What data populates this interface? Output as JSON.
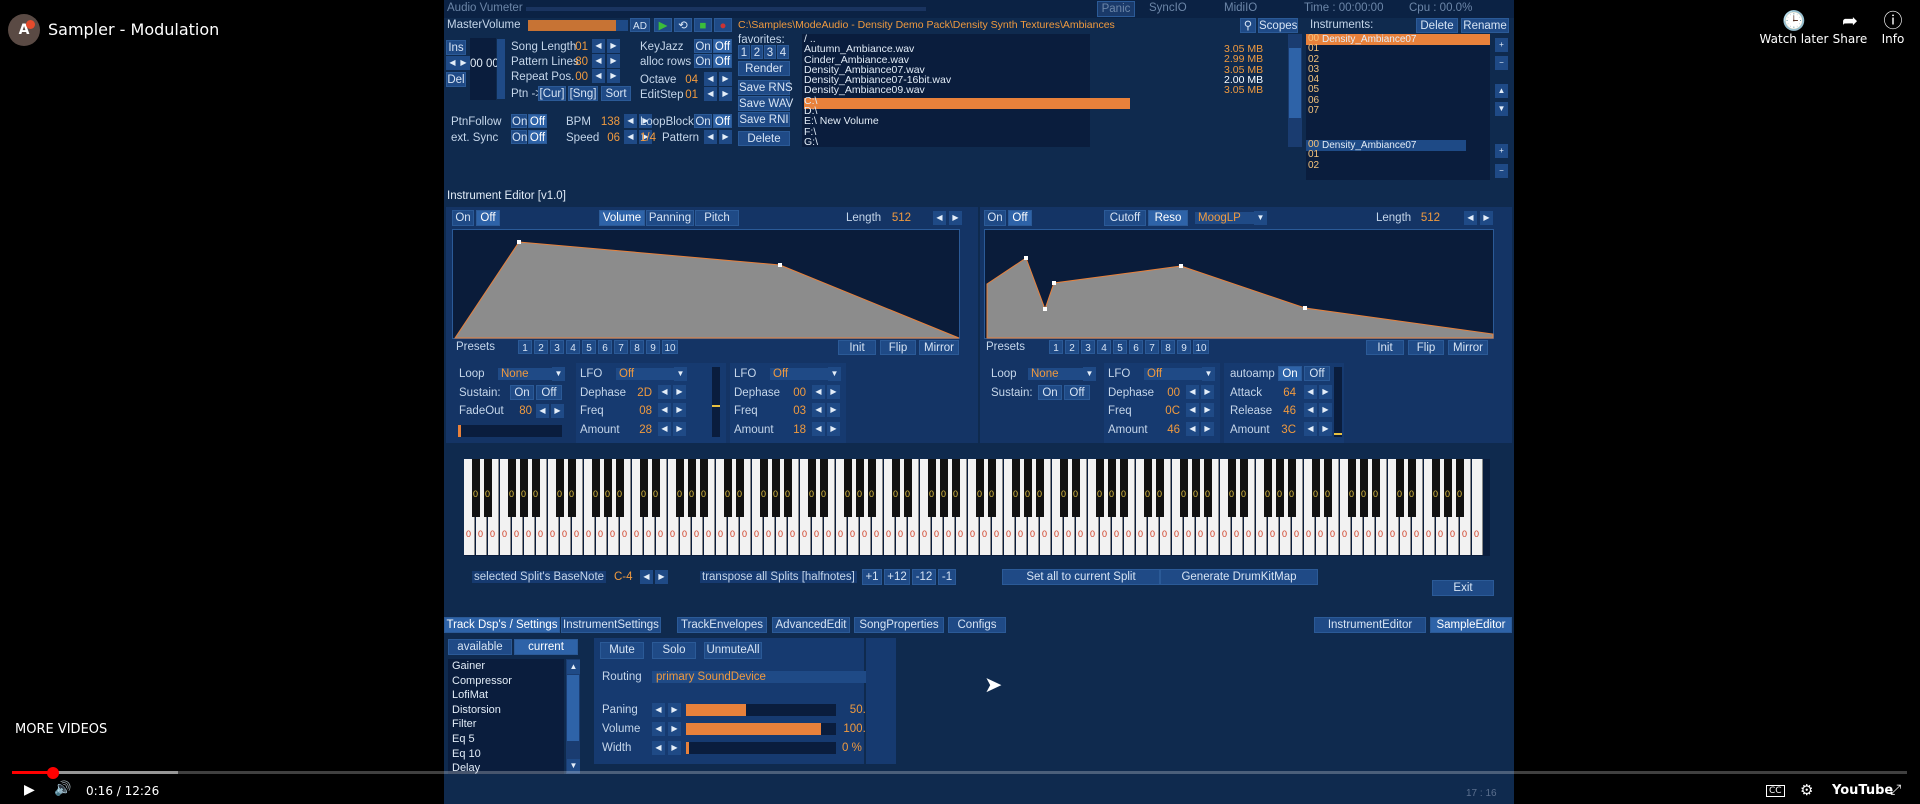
{
  "youtube": {
    "channel_initial": "A",
    "title": "Sampler - Modulation",
    "watch_later": "Watch later",
    "share": "Share",
    "info": "Info",
    "more_videos": "MORE VIDEOS",
    "time": "0:16 / 12:26",
    "brand": "YouTube",
    "progress_fraction": 0.0214
  },
  "app": {
    "top": {
      "audio_vumeter": "Audio Vumeter",
      "panic": "Panic",
      "sync": "SyncIO",
      "midi": "MidiIO",
      "time": "Time : 00:00:00",
      "cpu": "Cpu : 00.0%",
      "master_volume": "MasterVolume",
      "ad": "AD"
    },
    "left_controls": {
      "ins": "Ins",
      "del": "Del",
      "pattern_num": "00 00",
      "song_length": "Song Length",
      "song_length_val": "01",
      "pattern_lines": "Pattern Lines",
      "pattern_lines_val": "80",
      "repeat_pos": "Repeat Pos.",
      "repeat_pos_val": "00",
      "ptn": "Ptn ->",
      "cur": "[Cur]",
      "sng": "[Sng]",
      "sort": "Sort",
      "keyjazz": "KeyJazz",
      "alloc_rows": "alloc rows",
      "on": "On",
      "off": "Off",
      "octave": "Octave",
      "octave_val": "04",
      "editstep": "EditStep",
      "editstep_val": "01",
      "ptnfollow": "PtnFollow",
      "ext_sync": "ext. Sync",
      "bpm": "BPM",
      "bpm_val": "138",
      "speed": "Speed",
      "speed_val": "06",
      "loopblock": "LoopBlock",
      "quarter": "1/4",
      "pattern": "Pattern"
    },
    "browser": {
      "path": "C:\\Samples\\ModeAudio - Density Demo Pack\\Density Synth Textures\\Ambiances",
      "scopes": "Scopes",
      "favorites": "favorites:",
      "fav_nums": [
        "1",
        "2",
        "3",
        "4"
      ],
      "render": "Render",
      "save_rns": "Save RNS",
      "save_wav": "Save WAV",
      "save_rni": "Save RNI",
      "delete": "Delete",
      "files": [
        {
          "name": "/ ..",
          "size": ""
        },
        {
          "name": "Autumn_Ambiance.wav",
          "size": "3.05 MB"
        },
        {
          "name": "Cinder_Ambiance.wav",
          "size": "2.99 MB"
        },
        {
          "name": "Density_Ambiance07.wav",
          "size": "3.05 MB"
        },
        {
          "name": "Density_Ambiance07-16bit.wav",
          "size": "2.00 MB"
        },
        {
          "name": "Density_Ambiance09.wav",
          "size": "3.05 MB"
        },
        {
          "name": "C:\\",
          "size": ""
        },
        {
          "name": "D:\\",
          "size": ""
        },
        {
          "name": "E:\\  New Volume",
          "size": ""
        },
        {
          "name": "F:\\",
          "size": ""
        },
        {
          "name": "G:\\",
          "size": ""
        }
      ]
    },
    "instruments": {
      "label": "Instruments:",
      "delete": "Delete",
      "rename": "Rename",
      "top_list": [
        "00",
        "01",
        "02",
        "03",
        "04",
        "05",
        "06",
        "07"
      ],
      "top_name": "Density_Ambiance07",
      "bottom_list": [
        "00",
        "01",
        "02"
      ],
      "bottom_name": "Density_Ambiance07"
    },
    "editor": {
      "title": "Instrument Editor [v1.0]",
      "on": "On",
      "off": "Off",
      "volume": "Volume",
      "panning": "Panning",
      "pitch": "Pitch",
      "length": "Length",
      "length_val": "512",
      "cutoff": "Cutoff",
      "reso": "Reso",
      "filter": "MoogLP",
      "presets": "Presets",
      "preset_nums": [
        "1",
        "2",
        "3",
        "4",
        "5",
        "6",
        "7",
        "8",
        "9",
        "10"
      ],
      "init": "Init",
      "flip": "Flip",
      "mirror": "Mirror",
      "loop": "Loop",
      "none": "None",
      "sustain": "Sustain:",
      "fadeout": "FadeOut",
      "fadeout_val": "80",
      "lfo": "LFO",
      "lfo_off": "Off",
      "dephase": "Dephase",
      "freq": "Freq",
      "amount": "Amount",
      "lfo1": {
        "dephase": "2D",
        "freq": "08",
        "amount": "28"
      },
      "lfo2": {
        "dephase": "00",
        "freq": "03",
        "amount": "18"
      },
      "lfo3": {
        "dephase": "00",
        "freq": "0C",
        "amount": "46"
      },
      "autoamp": "autoamp",
      "attack": "Attack",
      "attack_val": "64",
      "release": "Release",
      "release_val": "46",
      "amount2_val": "3C"
    },
    "keyboard": {
      "note_label": "0",
      "basenote_label": "selected Split's BaseNote",
      "basenote_val": "C-4",
      "transpose_label": "transpose all Splits [halfnotes]",
      "p1": "+1",
      "p12": "+12",
      "m12": "-12",
      "m1": "-1",
      "set_all": "Set all to current Split",
      "gen_drum": "Generate DrumKitMap",
      "exit": "Exit"
    },
    "tabs": {
      "track_dsps": "Track Dsp's / Settings",
      "instrument_settings": "InstrumentSettings",
      "track_envelopes": "TrackEnvelopes",
      "advanced_edit": "AdvancedEdit",
      "song_properties": "SongProperties",
      "configs": "Configs",
      "instrument_editor": "InstrumentEditor",
      "sample_editor": "SampleEditor"
    },
    "dsp": {
      "available": "available",
      "current": "current",
      "list": [
        "Gainer",
        "Compressor",
        "LofiMat",
        "Distorsion",
        "Filter",
        "Eq 5",
        "Eq 10",
        "Delay"
      ],
      "mute": "Mute",
      "solo": "Solo",
      "unmute_all": "UnmuteAll",
      "routing": "Routing",
      "routing_val": "primary SoundDevice",
      "paning": "Paning",
      "paning_val": "50.00 %",
      "paning_fill": 0.5,
      "volume": "Volume",
      "volume_val": "100.00 %",
      "volume_fill": 0.9,
      "width": "Width",
      "width_val": "0 %",
      "width_fill": 0.0
    },
    "status": "17 : 16",
    "accent": "#f09a3f",
    "bg": "#0f2a4e"
  }
}
